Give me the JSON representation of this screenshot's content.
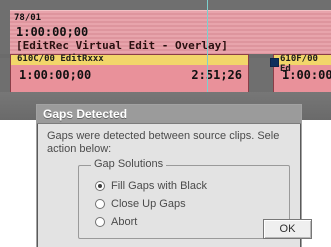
{
  "timeline": {
    "overlay": {
      "id": "78/01",
      "timecode": "1:00:00;00",
      "name": "[EditRec Virtual Edit - Overlay]"
    },
    "clips": [
      {
        "id": "610C/00 EditRxxx",
        "timecode": "1:00:00;00",
        "duration": "2:51;26"
      },
      {
        "id": "610F/00 Ed",
        "timecode": "1:00:00;00"
      }
    ]
  },
  "dialog": {
    "title": "Gaps Detected",
    "message_line_1": "Gaps were detected between source clips. Sele",
    "message_line_2": "action below:",
    "group_title": "Gap Solutions",
    "options": [
      {
        "label": "Fill Gaps with Black",
        "checked": true
      },
      {
        "label": "Close Up Gaps",
        "checked": false
      },
      {
        "label": "Abort",
        "checked": false
      }
    ],
    "ok_label": "OK"
  }
}
